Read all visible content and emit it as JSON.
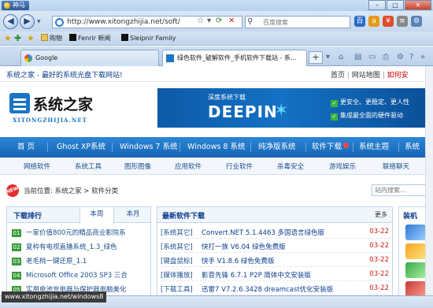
{
  "browser": {
    "app_menu": "神马",
    "url": "http://www.xitongzhijia.net/soft/",
    "search_placeholder": "百度搜索",
    "favorites": [
      "购物",
      "Fenrir 新闻",
      "Sleipnir Family"
    ],
    "tabs": [
      {
        "label": "Google",
        "active": false
      },
      {
        "label": "绿色软件_破解软件_手机软件下载站 - 系...",
        "active": true
      }
    ],
    "status_url": "www.xitongzhijia.net/windows8"
  },
  "page": {
    "slogan": "系统之家 - 最好的系统光盘下载网站!",
    "top_links": [
      "首页",
      "网站地图",
      "如何安"
    ],
    "logo": {
      "text": "系统之家",
      "sub": "XITONGZHIJIA.NET"
    },
    "banner": {
      "caption": "深度系统下载",
      "word": "DEEPIN",
      "features": [
        "更安全、更稳定、更人性",
        "集成最全面的硬件驱动"
      ]
    },
    "main_nav": [
      "首 页",
      "Ghost XP系统",
      "Windows 7 系统",
      "Windows 8 系统",
      "纯净版系统",
      "软件下载",
      "系统主题",
      "系统"
    ],
    "sub_nav": [
      "网络软件",
      "系统工具",
      "图形图像",
      "应用软件",
      "行业软件",
      "杀毒安全",
      "游戏娱乐",
      "联络聊天"
    ],
    "breadcrumb": {
      "badge": "NEW",
      "text": "当前位置: 系统之家 > 软件分类",
      "search_placeholder": "站内搜索..."
    },
    "ranking": {
      "title": "下载排行",
      "tabs": [
        "本周",
        "本月"
      ],
      "items": [
        {
          "num": "01",
          "name": "一家价值800元的精品商业影院系"
        },
        {
          "num": "02",
          "name": "夏枠有电视直播系统_1.3_绿色"
        },
        {
          "num": "03",
          "name": "老毛桃一键还原_1.1"
        },
        {
          "num": "04",
          "name": "Microsoft Office 2003 SP3 三合"
        },
        {
          "num": "05",
          "name": "实用电池充电器与保护器电脑美化"
        }
      ]
    },
    "latest": {
      "title": "最新软件下载",
      "more": "更多",
      "items": [
        {
          "cat": "[系统其它]",
          "name": "Convert.NET 5.1.4463 多国语言绿色版",
          "date": "03-22"
        },
        {
          "cat": "[系统其它]",
          "name": "快打一族 V6.04 绿色免费版",
          "date": "03-22"
        },
        {
          "cat": "[键盘鼠标]",
          "name": "快手 V1.8.6 绿色免费版",
          "date": "03-22"
        },
        {
          "cat": "[媒体播放]",
          "name": "影音先锋 6.7.1 P2P 简体中文安装版",
          "date": "03-22"
        },
        {
          "cat": "[下载工具]",
          "name": "迅雷7 V7.2.6.3428 dreamcast优化安装版",
          "date": "03-22"
        }
      ]
    },
    "right_panel_title": "装机"
  }
}
